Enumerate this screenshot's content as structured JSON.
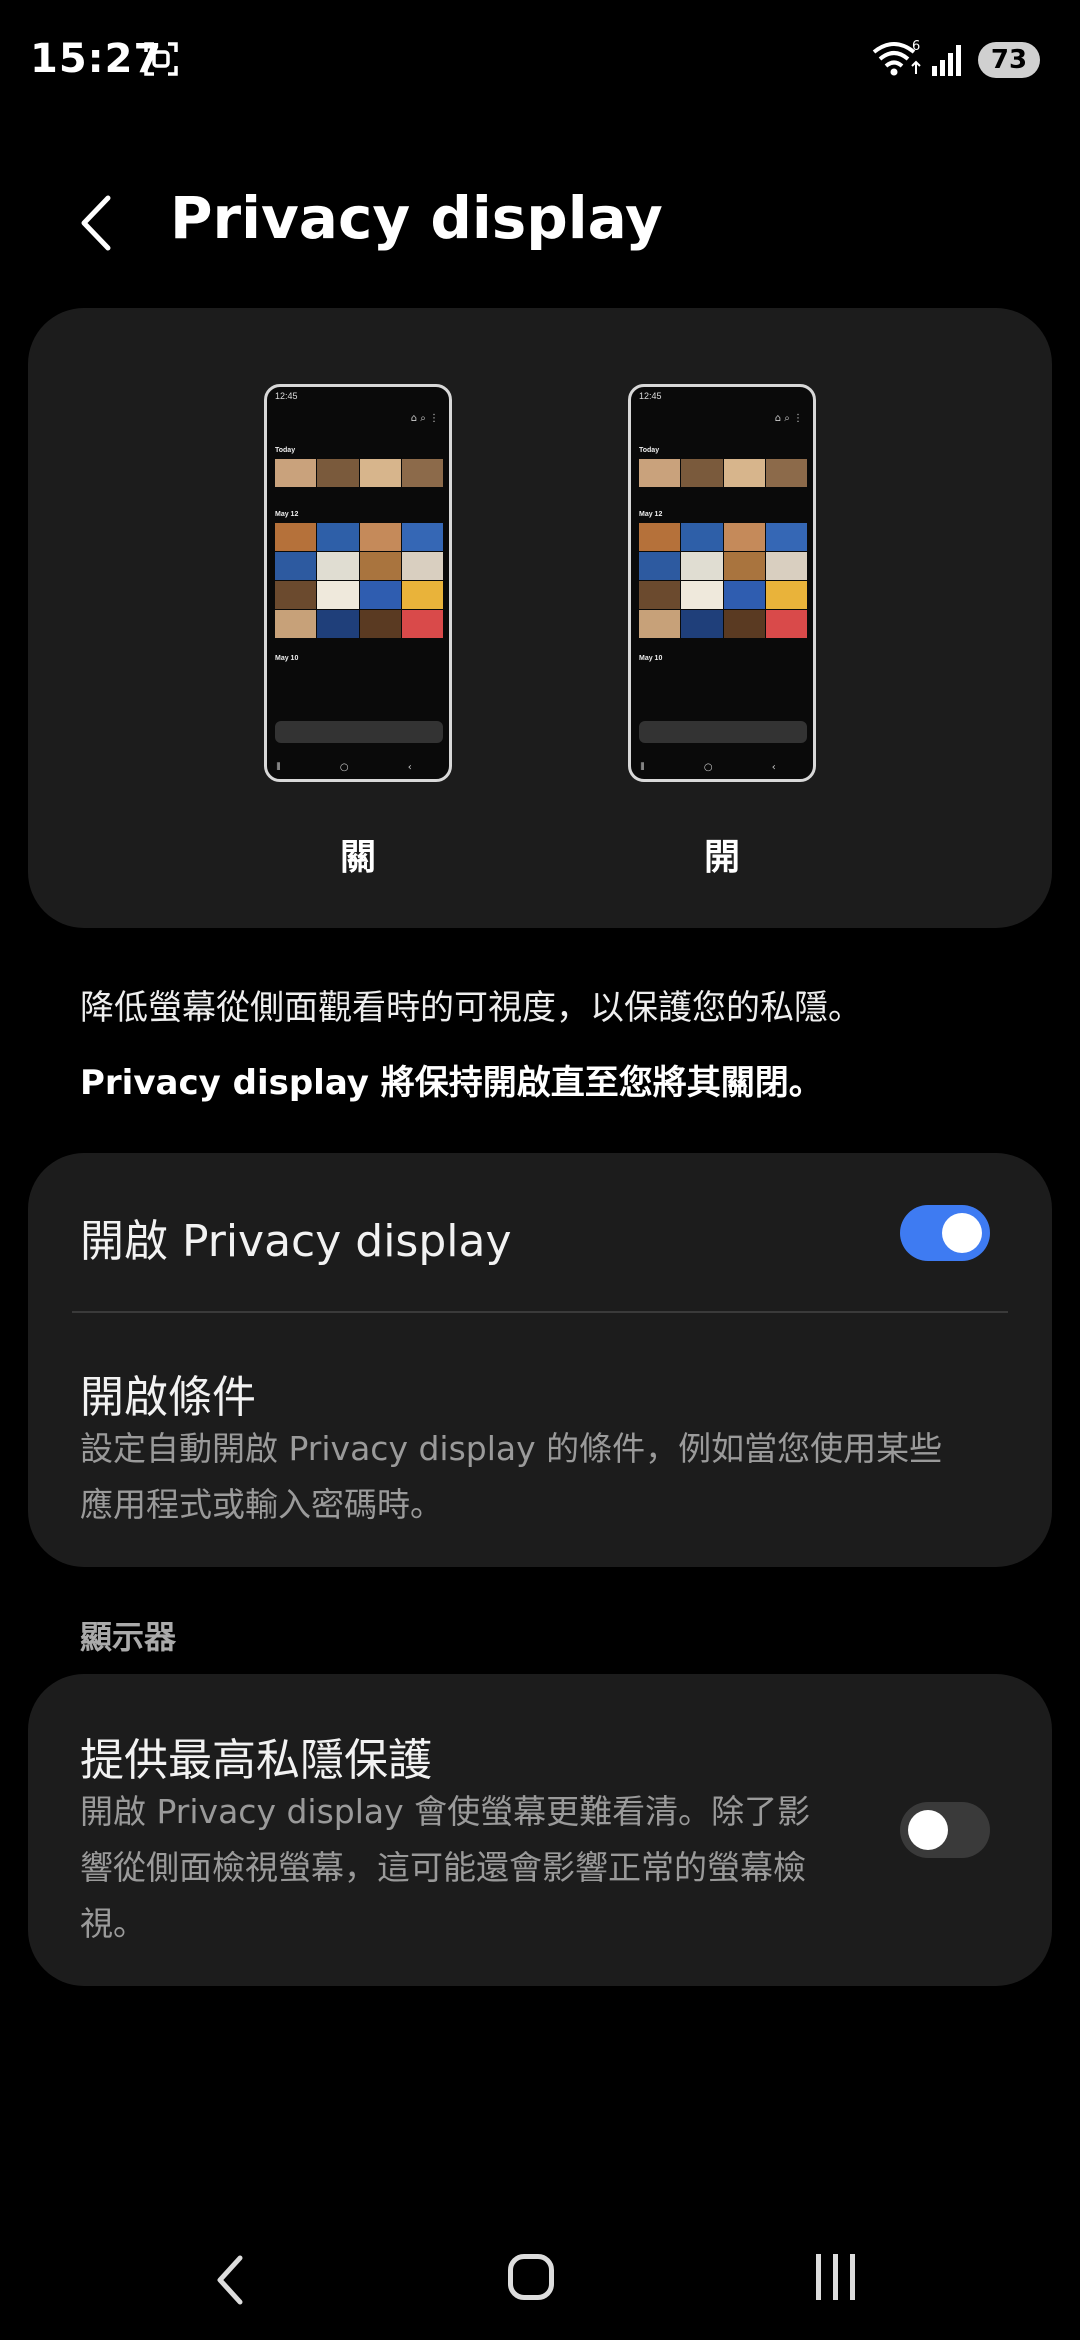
{
  "status": {
    "time": "15:27",
    "wifi_badge": "6",
    "battery": "73"
  },
  "header": {
    "title": "Privacy display"
  },
  "preview": {
    "off_label": "關",
    "on_label": "開",
    "phone_time": "12:45",
    "sections": [
      "Today",
      "May 12",
      "May 10"
    ]
  },
  "description": {
    "line1": "降低螢幕從側面觀看時的可視度，以保護您的私隱。",
    "line2": "Privacy display 將保持開啟直至您將其關閉。"
  },
  "toggle_card": {
    "enable_label": "開啟 Privacy display",
    "enable_on": true,
    "conditions_title": "開啟條件",
    "conditions_desc_line1": "設定自動開啟 Privacy display 的條件，例如當您使用某些",
    "conditions_desc_line2": "應用程式或輸入密碼時。"
  },
  "display_section": {
    "label": "顯示器",
    "max_title": "提供最高私隱保護",
    "max_desc_line1": "開啟 Privacy display 會使螢幕更難看清。除了影",
    "max_desc_line2": "響從側面檢視螢幕，這可能還會影響正常的螢幕檢",
    "max_desc_line3": "視。",
    "max_on": false
  },
  "colors": {
    "accent": "#3e7bf2",
    "card": "#1c1c1c",
    "background": "#000000"
  },
  "icons": [
    "screen-record-icon",
    "wifi-icon",
    "signal-icon",
    "back-arrow-icon",
    "nav-back-icon",
    "nav-home-icon",
    "nav-recent-icon"
  ]
}
